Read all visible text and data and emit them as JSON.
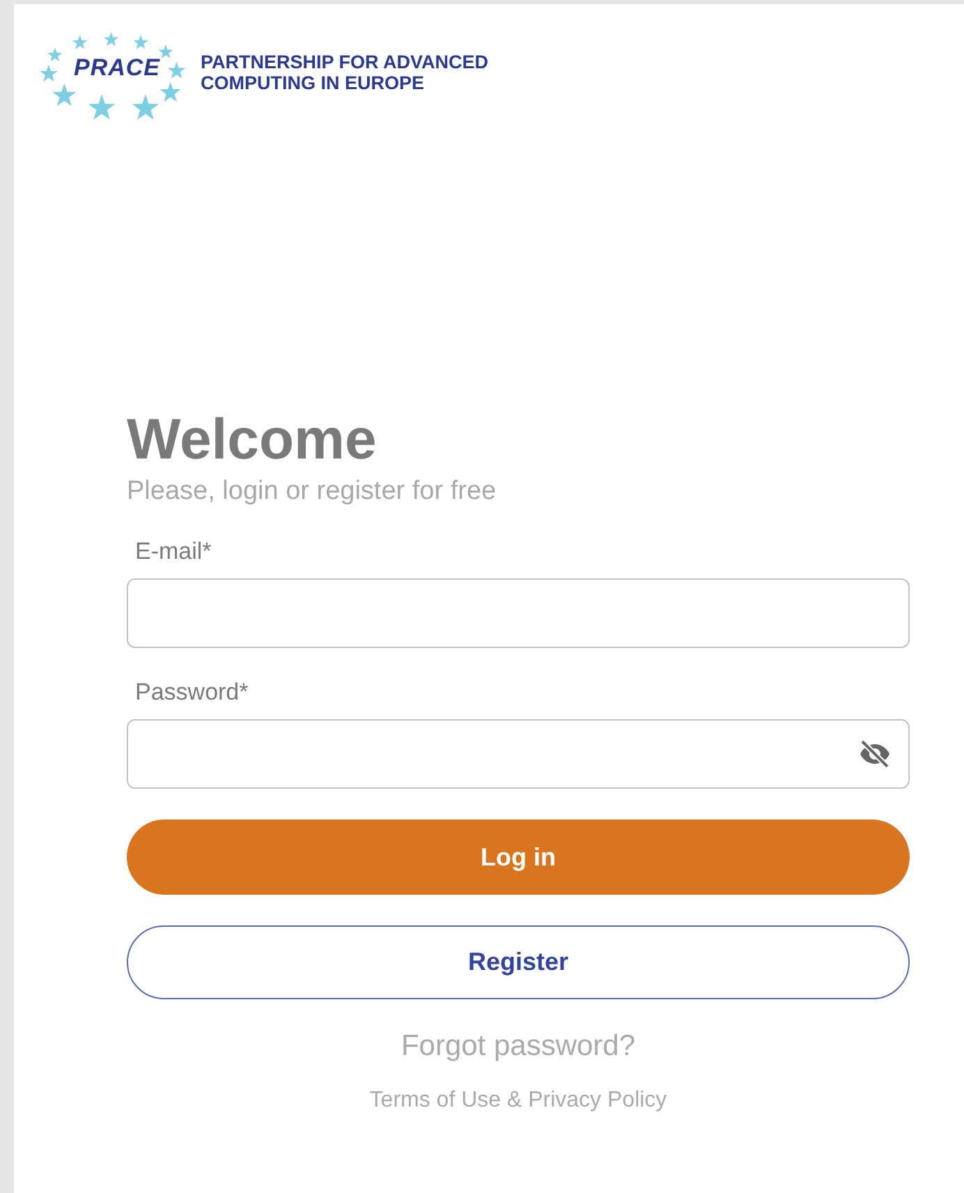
{
  "logo": {
    "mark": "PRACE",
    "tagline_lines": [
      "PARTNERSHIP FOR ADVANCED",
      "COMPUTING IN EUROPE"
    ]
  },
  "form": {
    "title": "Welcome",
    "subtitle": "Please, login or register for free",
    "fields": [
      {
        "label": "E-mail*",
        "kind": "email"
      },
      {
        "label": "Password*",
        "kind": "password"
      }
    ],
    "login_button": "Log in",
    "register_button": "Register",
    "forgot_link": "Forgot password?",
    "terms_link": "Terms of Use & Privacy Policy"
  }
}
